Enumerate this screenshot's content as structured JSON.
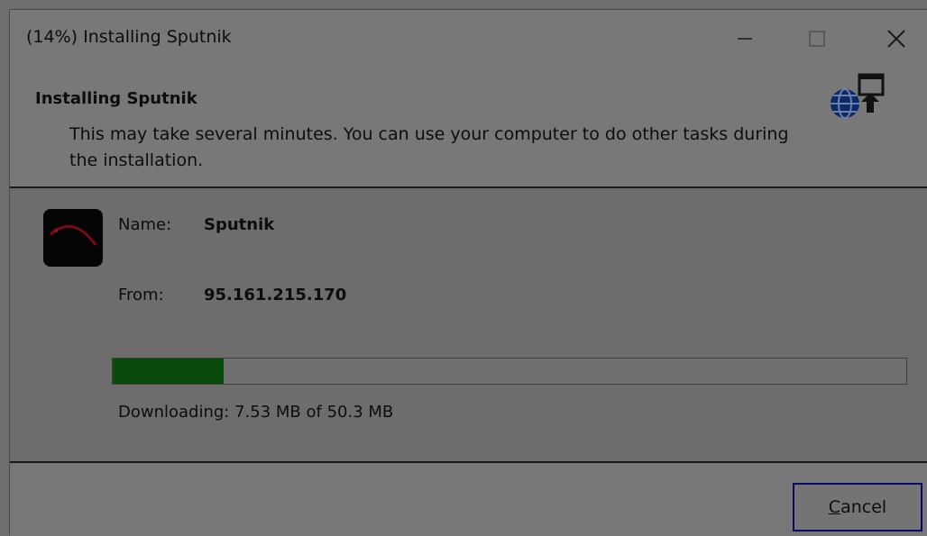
{
  "window": {
    "title": "(14%) Installing Sputnik",
    "controls": [
      "minimize-icon",
      "maximize-icon",
      "close-icon"
    ]
  },
  "header": {
    "title": "Installing Sputnik",
    "description": "This may take several minutes. You can use your computer to do other tasks during the installation.",
    "icon": "globe-install-icon"
  },
  "details": {
    "name_label": "Name:",
    "name_value": "Sputnik",
    "from_label": "From:",
    "from_value": "95.161.215.170",
    "app_icon": "sputnik-app-icon"
  },
  "progress": {
    "percent": 14,
    "status": "Downloading: 7.53 MB of 50.3 MB"
  },
  "footer": {
    "cancel_accel": "C",
    "cancel_rest": "ancel"
  },
  "colors": {
    "progress_fill": "#0a4a0a",
    "focus_border": "#0a0a6a"
  }
}
